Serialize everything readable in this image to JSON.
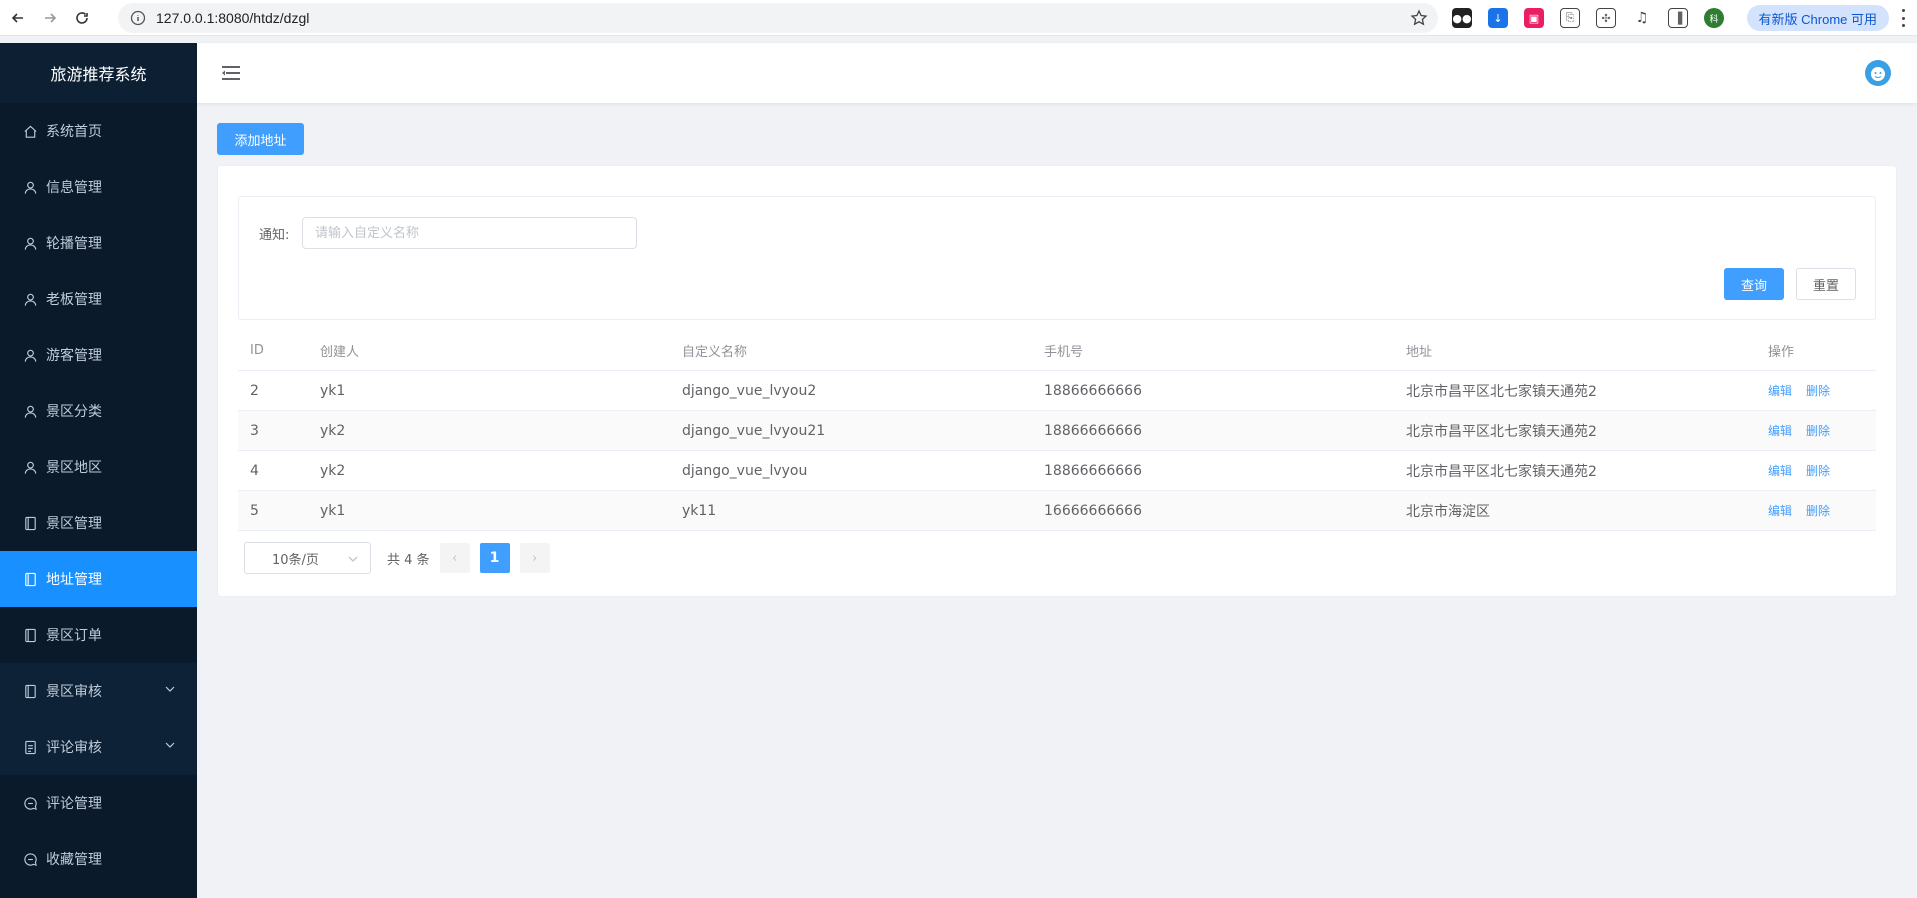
{
  "browser": {
    "url": "127.0.0.1:8080/htdz/dzgl",
    "update_label": "有新版 Chrome 可用"
  },
  "sidebar": {
    "title": "旅游推荐系统",
    "items": [
      {
        "label": "系统首页",
        "icon": "home-icon"
      },
      {
        "label": "信息管理",
        "icon": "user-icon"
      },
      {
        "label": "轮播管理",
        "icon": "user-icon"
      },
      {
        "label": "老板管理",
        "icon": "user-icon"
      },
      {
        "label": "游客管理",
        "icon": "user-icon"
      },
      {
        "label": "景区分类",
        "icon": "user-icon"
      },
      {
        "label": "景区地区",
        "icon": "user-icon"
      },
      {
        "label": "景区管理",
        "icon": "notebook-icon"
      },
      {
        "label": "地址管理",
        "icon": "notebook-icon",
        "active": true
      },
      {
        "label": "景区订单",
        "icon": "notebook-icon"
      },
      {
        "label": "景区审核",
        "icon": "notebook-icon",
        "submenu": true
      },
      {
        "label": "评论审核",
        "icon": "document-icon",
        "submenu": true
      },
      {
        "label": "评论管理",
        "icon": "chat-icon"
      },
      {
        "label": "收藏管理",
        "icon": "chat-icon"
      }
    ]
  },
  "toolbar": {
    "add_label": "添加地址"
  },
  "search": {
    "label": "通知:",
    "placeholder": "请输入自定义名称",
    "query_label": "查询",
    "reset_label": "重置"
  },
  "table": {
    "headers": [
      "ID",
      "创建人",
      "自定义名称",
      "手机号",
      "地址",
      "操作"
    ],
    "rows": [
      {
        "id": "2",
        "creator": "yk1",
        "name": "django_vue_lvyou2",
        "phone": "18866666666",
        "address": "北京市昌平区北七家镇天通苑2"
      },
      {
        "id": "3",
        "creator": "yk2",
        "name": "django_vue_lvyou21",
        "phone": "18866666666",
        "address": "北京市昌平区北七家镇天通苑2"
      },
      {
        "id": "4",
        "creator": "yk2",
        "name": "django_vue_lvyou",
        "phone": "18866666666",
        "address": "北京市昌平区北七家镇天通苑2"
      },
      {
        "id": "5",
        "creator": "yk1",
        "name": "yk11",
        "phone": "16666666666",
        "address": "北京市海淀区"
      }
    ],
    "edit_label": "编辑",
    "delete_label": "删除"
  },
  "pagination": {
    "page_size": "10条/页",
    "total": "共 4 条",
    "current_page": "1"
  },
  "colors": {
    "primary": "#409eff",
    "sidebar_bg": "#0a1a2a",
    "active_menu": "#1890ff"
  }
}
